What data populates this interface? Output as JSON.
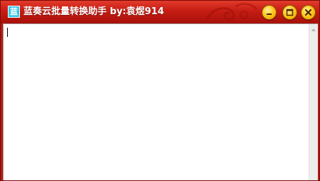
{
  "window": {
    "app_icon_glyph": "蓝",
    "title": "蓝奏云批量转换助手 by:袁煜914"
  },
  "colors": {
    "titlebar": "#c51d14",
    "window_border": "#7a0c08",
    "icon_bg": "#37c6ea",
    "button_gold": "#ffc81e",
    "content_bg": "#ffffff",
    "scrollbar_bg": "#ededed"
  },
  "controls": {
    "minimize_icon": "minimize-icon",
    "maximize_icon": "maximize-icon",
    "close_icon": "close-icon"
  },
  "editor": {
    "value": "",
    "scroll_up_icon": "scroll-up-arrow-icon"
  }
}
